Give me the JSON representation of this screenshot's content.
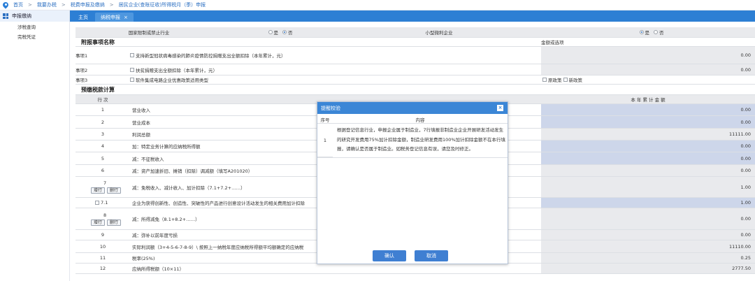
{
  "breadcrumb": [
    "首页",
    "我要办税",
    "税费申报及缴纳",
    "居民企业(查账征收)所得税月（季）申报"
  ],
  "sidebar": {
    "header": "申报缴纳",
    "items": [
      "涉税查询",
      "完税凭证"
    ]
  },
  "tabs": [
    {
      "label": "主页"
    },
    {
      "label": "纳税申报",
      "close": "×"
    }
  ],
  "form": {
    "top_row": {
      "label_left": "国家限制或禁止行业",
      "radio_left_yes": "是",
      "radio_left_no": "否",
      "label_mid": "小型微利企业",
      "radio_right_yes": "是",
      "radio_right_no": "否"
    },
    "section_fb": {
      "title": "附报事项名称",
      "amount_header": "金额或选项",
      "items": [
        {
          "name": "事项1",
          "desc": "支持新型冠状病毒感染的肺炎疫情防控捐赠支出全额扣除（本年累计，元）",
          "value": "0.00"
        },
        {
          "name": "事项2",
          "desc": "扶贫捐赠支出全额扣除（本年累计，元）",
          "value": "0.00"
        },
        {
          "name": "事项3",
          "desc": "软件集成电路企业优惠政策适用类型",
          "opt1": "原政策",
          "opt2": "新政策"
        }
      ]
    },
    "section_yj": {
      "title": "预缴税款计算",
      "col_hangci": "行 次",
      "col_amount": "本 年 累 计 金 额",
      "btn_add": "增行",
      "btn_del": "删行",
      "rows": [
        {
          "num": "1",
          "label": "营业收入",
          "value": "0.00"
        },
        {
          "num": "2",
          "label": "营业成本",
          "value": "0.00"
        },
        {
          "num": "3",
          "label": "利润总额",
          "value": "11111.00"
        },
        {
          "num": "4",
          "label": "加：特定业务计算的应纳税所得额",
          "value": "0.00"
        },
        {
          "num": "5",
          "label": "减：不征税收入",
          "value": "0.00"
        },
        {
          "num": "6",
          "label": "减：资产加速折旧、摊销（扣除）调减额（填写A201020）",
          "value": "0.00"
        },
        {
          "num": "7",
          "label": "减：免税收入、减计收入、加计扣除（7.1+7.2+……）",
          "value": "1.00"
        },
        {
          "num": "7.1",
          "label": "企业为获得创新性、创造性、突破性的产品进行创意设计活动发生的相关费用加计扣除",
          "value": "1.00"
        },
        {
          "num": "8",
          "label": "减：所得减免（8.1+8.2+……）",
          "value": "0.00"
        },
        {
          "num": "9",
          "label": "减：弥补以前年度亏损",
          "value": "0.00"
        },
        {
          "num": "10",
          "label": "实际利润额（3+4-5-6-7-8-9）\\ 按照上一纳税年度应纳税所得额平均额确定的应纳税",
          "value": "11110.00"
        },
        {
          "num": "11",
          "label": "税率(25%)",
          "value": "0.25"
        },
        {
          "num": "12",
          "label": "应纳所得税额（10×11）",
          "value": "2777.50"
        }
      ]
    }
  },
  "dialog": {
    "title": "提醒校验",
    "close": "×",
    "col_seq": "序号",
    "col_content": "内容",
    "seq": "1",
    "message": "根据登记信息行业，申报企业属于制造业，7行填报非制造业企业开展研发活动发生的研究开发费用75%加计扣除金额，制造业研发费用100%加计扣除金额不在本行填报，请确认是否属于制造业。如税务登记信息有误，请您及时修正。",
    "confirm": "确认",
    "cancel": "取消"
  },
  "colors": {
    "accent": "#2d7fd4",
    "dialog_header": "#3b86d6",
    "readonly_gray": "#e9eaed",
    "editable_blue": "#cdd6ea"
  }
}
